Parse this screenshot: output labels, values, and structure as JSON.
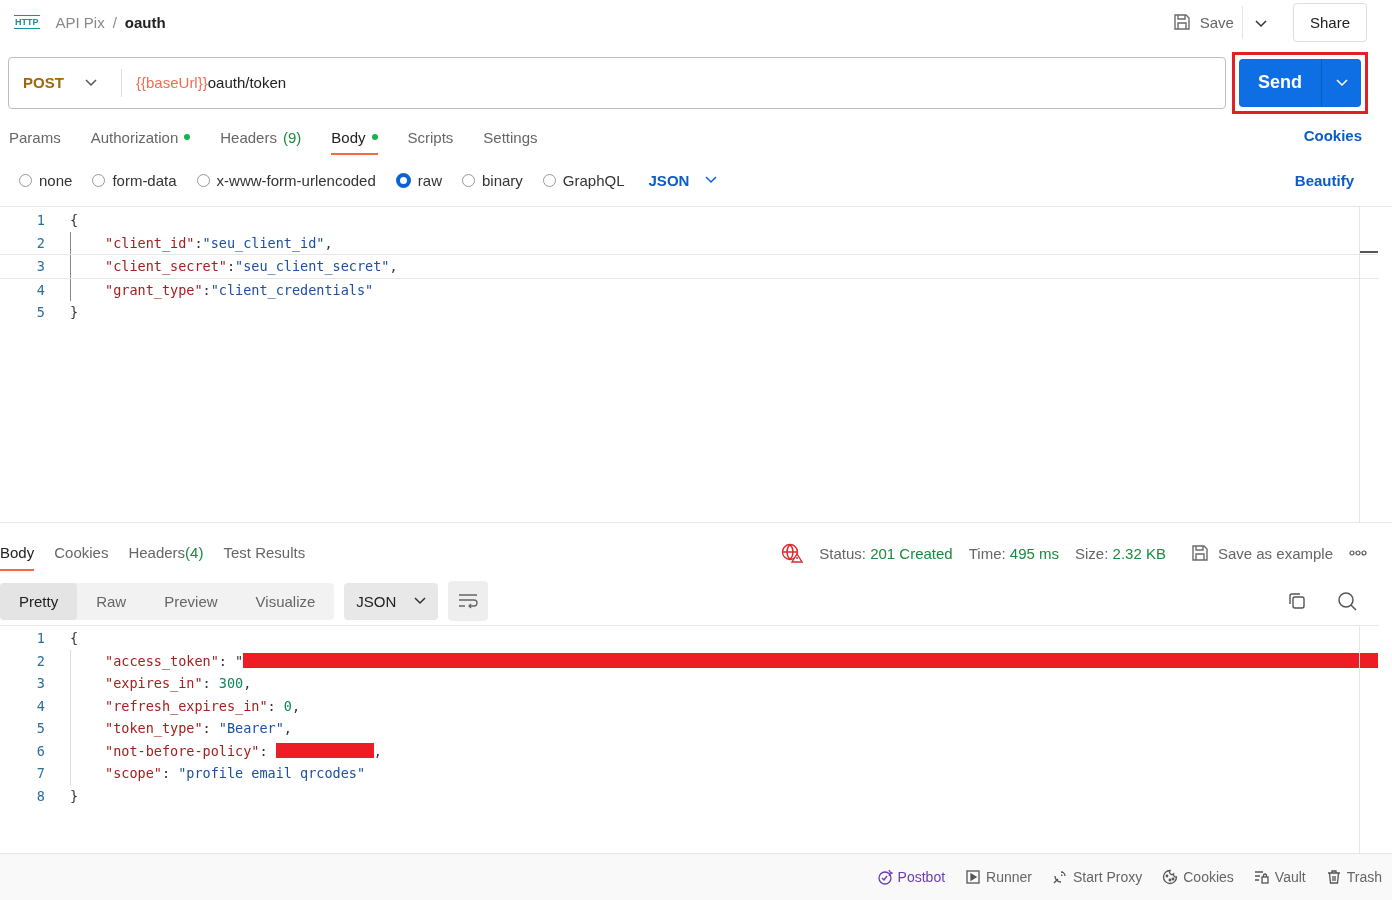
{
  "breadcrumb": {
    "type_badge": "HTTP",
    "collection": "API Pix",
    "separator": "/",
    "request": "oauth"
  },
  "header_actions": {
    "save": "Save",
    "share": "Share"
  },
  "request": {
    "method": "POST",
    "url_variable": "{{baseUrl}}",
    "url_path": "oauth/token",
    "send": "Send",
    "send_highlighted": true
  },
  "request_tabs": [
    {
      "label": "Params",
      "selected": false,
      "dot": false
    },
    {
      "label": "Authorization",
      "selected": false,
      "dot": true
    },
    {
      "label": "Headers",
      "count": "(9)",
      "selected": false,
      "dot": false
    },
    {
      "label": "Body",
      "selected": true,
      "dot": true
    },
    {
      "label": "Scripts",
      "selected": false,
      "dot": false
    },
    {
      "label": "Settings",
      "selected": false,
      "dot": false
    }
  ],
  "cookies_link": "Cookies",
  "body_types": [
    {
      "label": "none",
      "selected": false
    },
    {
      "label": "form-data",
      "selected": false
    },
    {
      "label": "x-www-form-urlencoded",
      "selected": false
    },
    {
      "label": "raw",
      "selected": true
    },
    {
      "label": "binary",
      "selected": false
    },
    {
      "label": "GraphQL",
      "selected": false
    }
  ],
  "body_format": "JSON",
  "beautify": "Beautify",
  "request_body": [
    {
      "num": "1",
      "indented": false,
      "active": false,
      "tokens": [
        {
          "kind": "punct",
          "text": "{"
        }
      ]
    },
    {
      "num": "2",
      "indented": true,
      "active": false,
      "tokens": [
        {
          "kind": "key",
          "text": "\"client_id\""
        },
        {
          "kind": "punct",
          "text": ":"
        },
        {
          "kind": "string",
          "text": "\"seu_client_id\""
        },
        {
          "kind": "punct",
          "text": ","
        }
      ]
    },
    {
      "num": "3",
      "indented": true,
      "active": true,
      "tokens": [
        {
          "kind": "key",
          "text": "\"client_secret\""
        },
        {
          "kind": "punct",
          "text": ":"
        },
        {
          "kind": "string",
          "text": "\"seu_client_secret\""
        },
        {
          "kind": "punct",
          "text": ","
        }
      ]
    },
    {
      "num": "4",
      "indented": true,
      "active": false,
      "tokens": [
        {
          "kind": "key",
          "text": "\"grant_type\""
        },
        {
          "kind": "punct",
          "text": ":"
        },
        {
          "kind": "string",
          "text": "\"client_credentials\""
        }
      ]
    },
    {
      "num": "5",
      "indented": false,
      "active": false,
      "tokens": [
        {
          "kind": "punct",
          "text": "}"
        }
      ]
    }
  ],
  "response_tabs": [
    {
      "label": "Body",
      "selected": true
    },
    {
      "label": "Cookies",
      "selected": false
    },
    {
      "label": "Headers",
      "count": "(4)",
      "selected": false
    },
    {
      "label": "Test Results",
      "selected": false
    }
  ],
  "status": [
    {
      "label": "Status:",
      "value": "201 Created"
    },
    {
      "label": "Time:",
      "value": "495 ms"
    },
    {
      "label": "Size:",
      "value": "2.32 KB"
    }
  ],
  "save_example": "Save as example",
  "view_modes": [
    {
      "label": "Pretty",
      "selected": true
    },
    {
      "label": "Raw",
      "selected": false
    },
    {
      "label": "Preview",
      "selected": false
    },
    {
      "label": "Visualize",
      "selected": false
    }
  ],
  "response_format": "JSON",
  "response_body": [
    {
      "num": "1",
      "indented": false,
      "tokens": [
        {
          "kind": "punct",
          "text": "{"
        }
      ]
    },
    {
      "num": "2",
      "indented": true,
      "tokens": [
        {
          "kind": "key",
          "text": "\"access_token\""
        },
        {
          "kind": "punct",
          "text": ": \""
        },
        {
          "kind": "redacted"
        }
      ]
    },
    {
      "num": "3",
      "indented": true,
      "tokens": [
        {
          "kind": "key",
          "text": "\"expires_in\""
        },
        {
          "kind": "punct",
          "text": ": "
        },
        {
          "kind": "number",
          "text": "300"
        },
        {
          "kind": "punct",
          "text": ","
        }
      ]
    },
    {
      "num": "4",
      "indented": true,
      "tokens": [
        {
          "kind": "key",
          "text": "\"refresh_expires_in\""
        },
        {
          "kind": "punct",
          "text": ": "
        },
        {
          "kind": "number",
          "text": "0"
        },
        {
          "kind": "punct",
          "text": ","
        }
      ]
    },
    {
      "num": "5",
      "indented": true,
      "tokens": [
        {
          "kind": "key",
          "text": "\"token_type\""
        },
        {
          "kind": "punct",
          "text": ": "
        },
        {
          "kind": "string",
          "text": "\"Bearer\""
        },
        {
          "kind": "punct",
          "text": ","
        }
      ]
    },
    {
      "num": "6",
      "indented": true,
      "tokens": [
        {
          "kind": "key",
          "text": "\"not-before-policy\""
        },
        {
          "kind": "punct",
          "text": ": "
        },
        {
          "kind": "redacted"
        },
        {
          "kind": "punct",
          "text": ","
        }
      ]
    },
    {
      "num": "7",
      "indented": true,
      "tokens": [
        {
          "kind": "key",
          "text": "\"scope\""
        },
        {
          "kind": "punct",
          "text": ": "
        },
        {
          "kind": "string",
          "text": "\"profile email qrcodes\""
        }
      ]
    },
    {
      "num": "8",
      "indented": false,
      "tokens": [
        {
          "kind": "punct",
          "text": "}"
        }
      ]
    }
  ],
  "footer": [
    {
      "kind": "postbot",
      "label": "Postbot"
    },
    {
      "kind": "runner",
      "label": "Runner"
    },
    {
      "kind": "proxy",
      "label": "Start Proxy"
    },
    {
      "kind": "cookies",
      "label": "Cookies"
    },
    {
      "kind": "vault",
      "label": "Vault"
    },
    {
      "kind": "trash",
      "label": "Trash"
    }
  ]
}
